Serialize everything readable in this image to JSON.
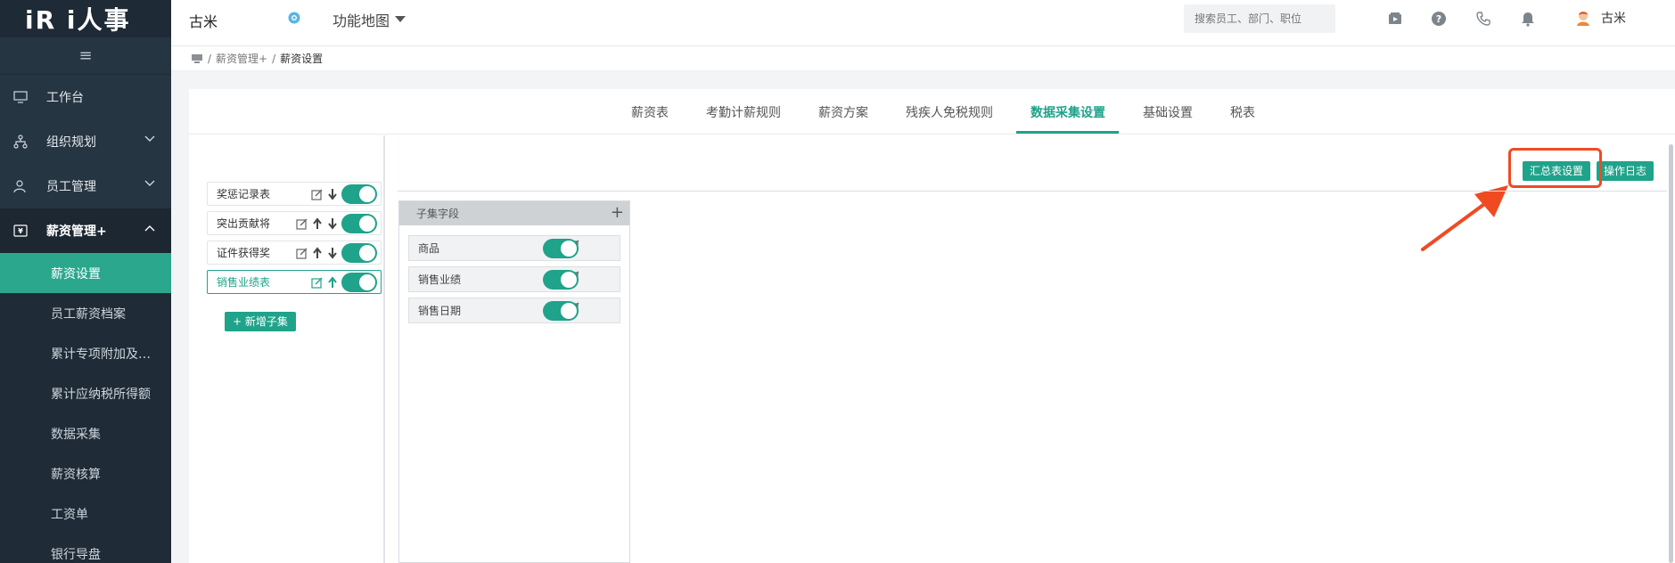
{
  "app": {
    "logo": "iR i人事"
  },
  "sidebar": {
    "collapse": "≡",
    "items": [
      {
        "label": "工作台"
      },
      {
        "label": "组织规划"
      },
      {
        "label": "员工管理"
      },
      {
        "label": "薪资管理+"
      }
    ],
    "subitems": [
      {
        "label": "薪资设置"
      },
      {
        "label": "员工薪资档案"
      },
      {
        "label": "累计专项附加及…"
      },
      {
        "label": "累计应纳税所得额"
      },
      {
        "label": "数据采集"
      },
      {
        "label": "薪资核算"
      },
      {
        "label": "工资单"
      },
      {
        "label": "银行导盘"
      }
    ]
  },
  "header": {
    "company": "古米",
    "function_map": "功能地图",
    "search_placeholder": "搜索员工、部门、职位",
    "user_name": "古米"
  },
  "breadcrumb": {
    "parent": "薪资管理+",
    "current": "薪资设置",
    "sep": "/"
  },
  "tabs": [
    {
      "label": "薪资表"
    },
    {
      "label": "考勤计薪规则"
    },
    {
      "label": "薪资方案"
    },
    {
      "label": "残疾人免税规则"
    },
    {
      "label": "数据采集设置"
    },
    {
      "label": "基础设置"
    },
    {
      "label": "税表"
    }
  ],
  "toolbar": {
    "summary_settings": "汇总表设置",
    "operation_log": "操作日志"
  },
  "sets": [
    {
      "label": "奖惩记录表"
    },
    {
      "label": "突出贡献将"
    },
    {
      "label": "证件获得奖"
    },
    {
      "label": "销售业绩表"
    }
  ],
  "add_subset": "+ 新增子集",
  "panel": {
    "title": "子集字段",
    "fields": [
      {
        "label": "商品"
      },
      {
        "label": "销售业绩"
      },
      {
        "label": "销售日期"
      }
    ]
  },
  "colors": {
    "accent": "#1fa38a",
    "sidebar_bg": "#263542",
    "annotation": "#f04a23"
  }
}
